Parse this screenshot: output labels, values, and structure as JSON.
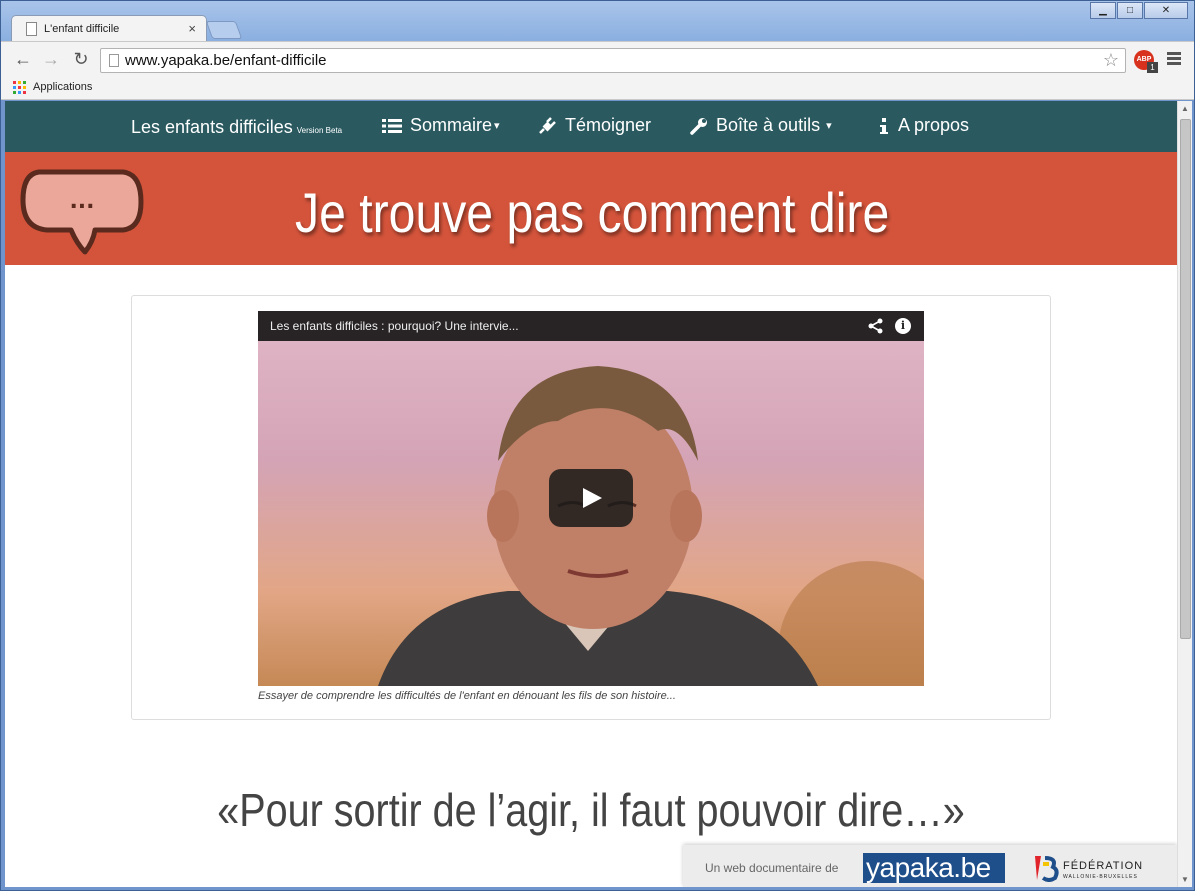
{
  "browser": {
    "tab_title": "L'enfant difficile",
    "tab_close": "×",
    "url": "www.yapaka.be/enfant-difficile",
    "bookmarks": {
      "apps_label": "Applications"
    },
    "abp_label": "ABP",
    "abp_count": "1",
    "window_buttons": {
      "minimize": "▁",
      "maximize": "□",
      "close": "✕"
    },
    "nav": {
      "back": "←",
      "forward": "→",
      "reload": "↻",
      "star": "☆"
    }
  },
  "site_nav": {
    "brand": "Les enfants difficiles",
    "brand_tag": "Version Beta",
    "items": [
      {
        "label": "Sommaire",
        "caret": "▾",
        "icon": "list-icon"
      },
      {
        "label": "Témoigner",
        "icon": "plug-icon"
      },
      {
        "label": "Boîte à outils",
        "caret": "▾",
        "icon": "wrench-icon"
      },
      {
        "label": "A propos",
        "icon": "info-icon"
      }
    ]
  },
  "banner": {
    "title": "Je trouve pas comment dire",
    "bubble_text": "...",
    "color": "#d4543b"
  },
  "video": {
    "title": "Les enfants difficiles : pourquoi? Une intervie...",
    "caption": "Essayer de comprendre les difficultés de l'enfant en dénouant les fils de son histoire...",
    "info_label": "i"
  },
  "quote": "«Pour sortir de l’agir, il faut pouvoir dire…»",
  "partner": {
    "label": "Un web documentaire de",
    "yapaka": "yapaka.be",
    "federation": "FÉDÉRATION",
    "federation_sub": "WALLONIE-BRUXELLES"
  },
  "colors": {
    "nav_bg": "#2a5a60",
    "banner_bg": "#d4543b",
    "yapaka_bg": "#1f4f8a"
  }
}
